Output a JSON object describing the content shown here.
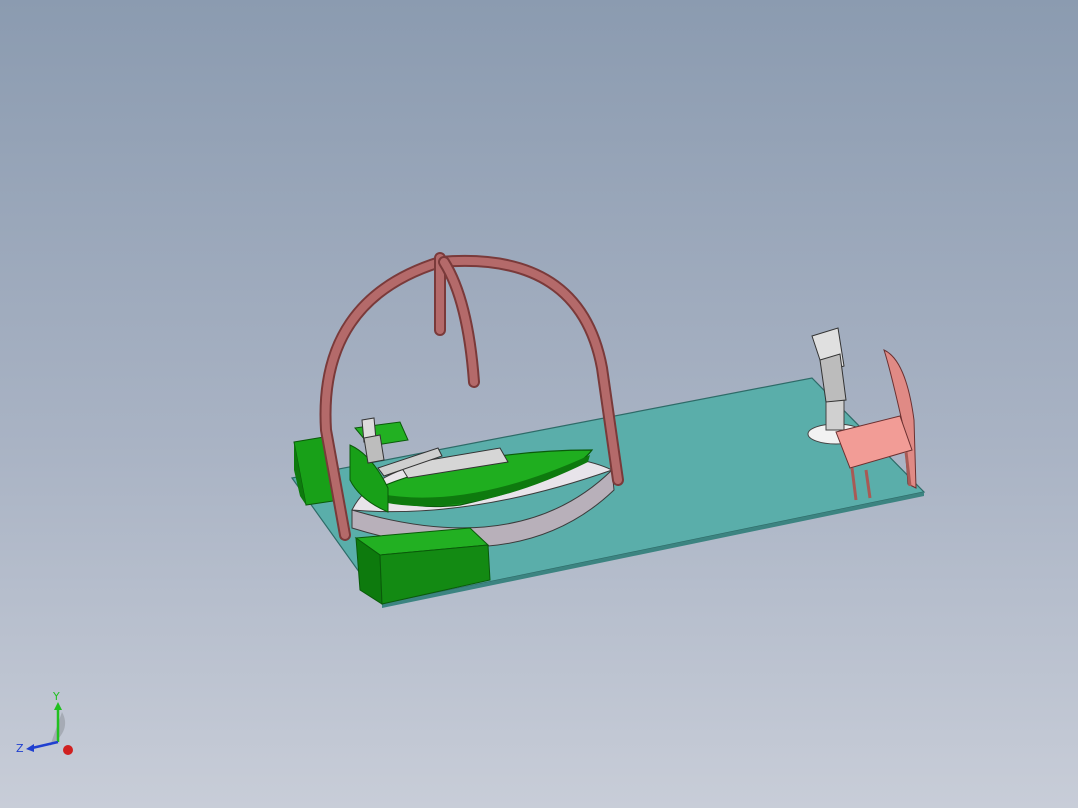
{
  "viewport": {
    "background_top": "#8b9bb0",
    "background_bottom": "#c8cdd8"
  },
  "model": {
    "parts": [
      "base-plate",
      "arch-frame",
      "green-blocks",
      "rotating-platform",
      "green-boat",
      "robot-arm",
      "chair"
    ],
    "colors": {
      "base_plate": "#5aaeaa",
      "arch": "#b06464",
      "green": "#1fa81f",
      "green_dark": "#0f7a0f",
      "platform": "#c8c0c8",
      "chair": "#e89590",
      "robot": "#d8d8d8"
    }
  },
  "triad": {
    "x_label": "",
    "y_label": "Y",
    "z_label": "Z",
    "x_color": "#cc2020",
    "y_color": "#20c020",
    "z_color": "#2040d0"
  }
}
